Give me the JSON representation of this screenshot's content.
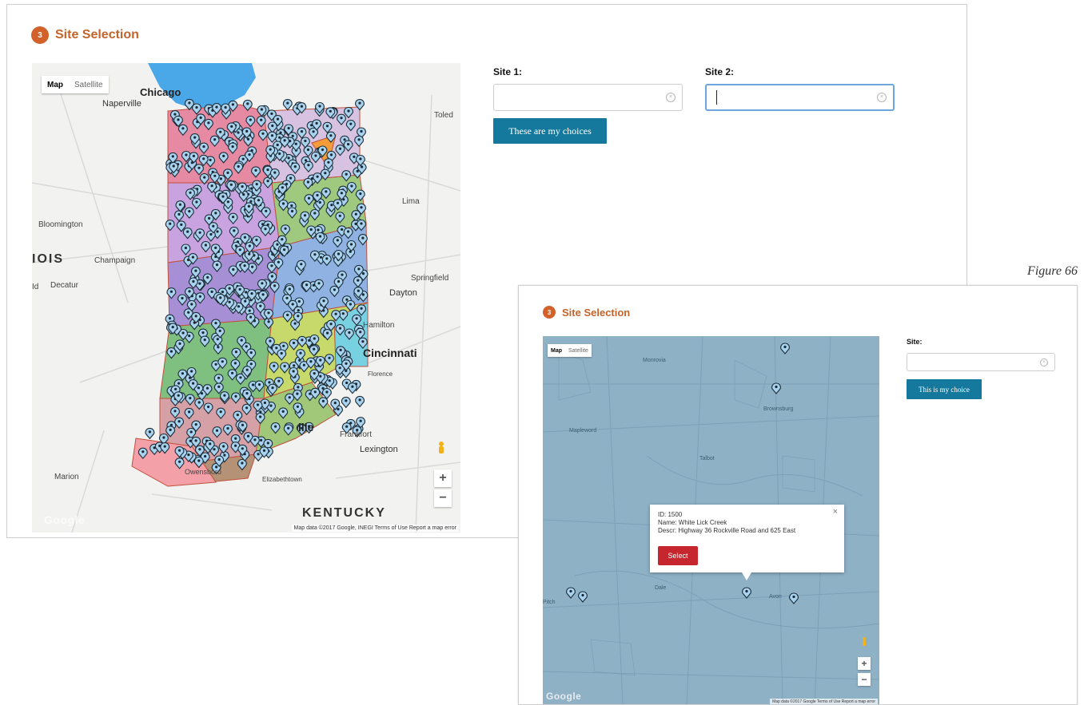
{
  "figure_caption": "Figure 66",
  "panel1": {
    "step_number": "3",
    "step_title": "Site Selection",
    "map": {
      "mode_map": "Map",
      "mode_satellite": "Satellite",
      "labels": {
        "chicago": "Chicago",
        "naperville": "Naperville",
        "toledo": "Toled",
        "lima": "Lima",
        "bloomington": "Bloomington",
        "illinois": "IOIS",
        "champaign": "Champaign",
        "decatur": "Decatur",
        "springfield": "Springfield",
        "dayton": "Dayton",
        "hamilton": "Hamilton",
        "cincinnati": "Cincinnati",
        "florence": "Florence",
        "frankfort": "Frankfort",
        "lexington": "Lexington",
        "louisville": "ille",
        "marion": "Marion",
        "elizabethtown": "Elizabethtown",
        "owensboro": "Owensboro",
        "kentucky": "KENTUCKY",
        "id_left": "Id"
      },
      "attribution": "Map data ©2017 Google, INEGI   Terms of Use   Report a map error",
      "google_logo": "Google",
      "zoom_in": "+",
      "zoom_out": "−"
    },
    "site1_label": "Site 1:",
    "site1_value": "",
    "site2_label": "Site 2:",
    "site2_value": "",
    "submit_label": "These are my choices"
  },
  "panel2": {
    "step_number": "3",
    "step_title": "Site Selection",
    "map": {
      "mode_map": "Map",
      "mode_satellite": "Satellite",
      "labels": {
        "t1": "Monrovia",
        "t2": "Brownsburg",
        "t3": "Mapleword",
        "t4": "Talbot",
        "t5": "Dale",
        "t6": "Avon",
        "t7": "Pitch"
      },
      "attribution": "Map data ©2017 Google   Terms of Use   Report a map error",
      "google_logo": "Google",
      "zoom_in": "+",
      "zoom_out": "−"
    },
    "popup": {
      "line1": "ID: 1500",
      "line2": "Name: White Lick Creek",
      "line3": "Descr: Highway 36 Rockville Road and 625 East",
      "close": "×",
      "select_label": "Select"
    },
    "site_label": "Site:",
    "site_value": "",
    "submit_label": "This is my choice"
  },
  "colors": {
    "accent_orange": "#d2612a",
    "button_blue": "#14799c",
    "select_red": "#c6262e",
    "focus_border": "#6aa7dd",
    "lake_blue": "#4aa8e8",
    "map_bg": "#f2f2f0",
    "satellite_tint": "#8fb1c6"
  }
}
